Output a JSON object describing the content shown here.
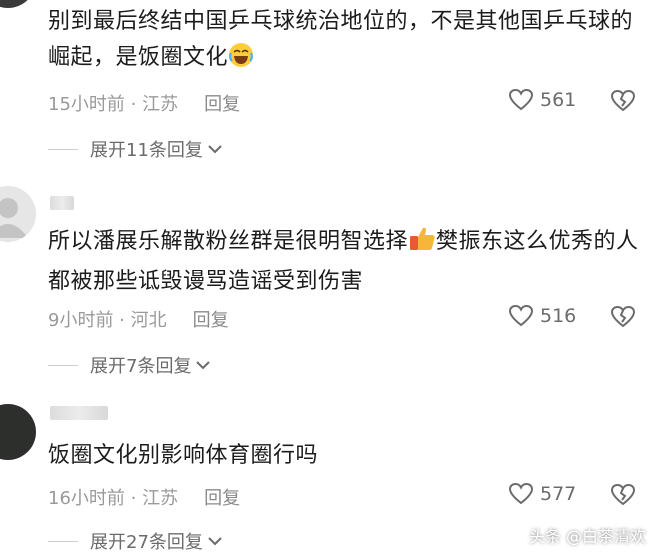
{
  "comments": [
    {
      "text": "别到最后终结中国乒乓球统治地位的，不是其他国乒乓球的崛起，是饭圈文化",
      "emoji": "laughing-crying-emoji",
      "time": "15小时前",
      "location": "江苏",
      "reply": "回复",
      "likes": "561",
      "expand": "展开11条回复"
    },
    {
      "text": "所以潘展乐解散粉丝群是很明智选择",
      "emoji": "thumbs-up-emoji",
      "text_after": "樊振东这么优秀的人都被那些诋毁谩骂造谣受到伤害",
      "time": "9小时前",
      "location": "河北",
      "reply": "回复",
      "likes": "516",
      "expand": "展开7条回复"
    },
    {
      "text": "饭圈文化别影响体育圈行吗",
      "time": "16小时前",
      "location": "江苏",
      "reply": "回复",
      "likes": "577",
      "expand": "展开27条回复"
    }
  ],
  "watermark": "头条 @白茶清欢",
  "colors": {
    "text": "#1c1c1c",
    "meta": "#9a9a9a",
    "icon": "#6b6b6b"
  }
}
